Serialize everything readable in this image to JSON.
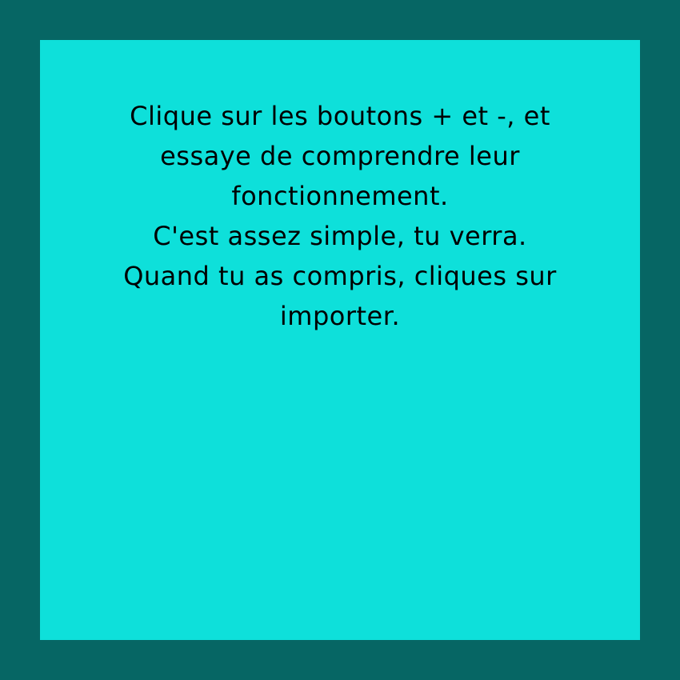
{
  "colors": {
    "background": "#066664",
    "panel": "#0ee0da",
    "text": "#000000"
  },
  "instructions": {
    "lines": [
      "Clique sur les boutons + et -, et",
      "essaye de comprendre leur",
      "fonctionnement.",
      "C'est assez simple, tu verra.",
      "Quand tu as compris, cliques sur",
      "importer."
    ]
  }
}
